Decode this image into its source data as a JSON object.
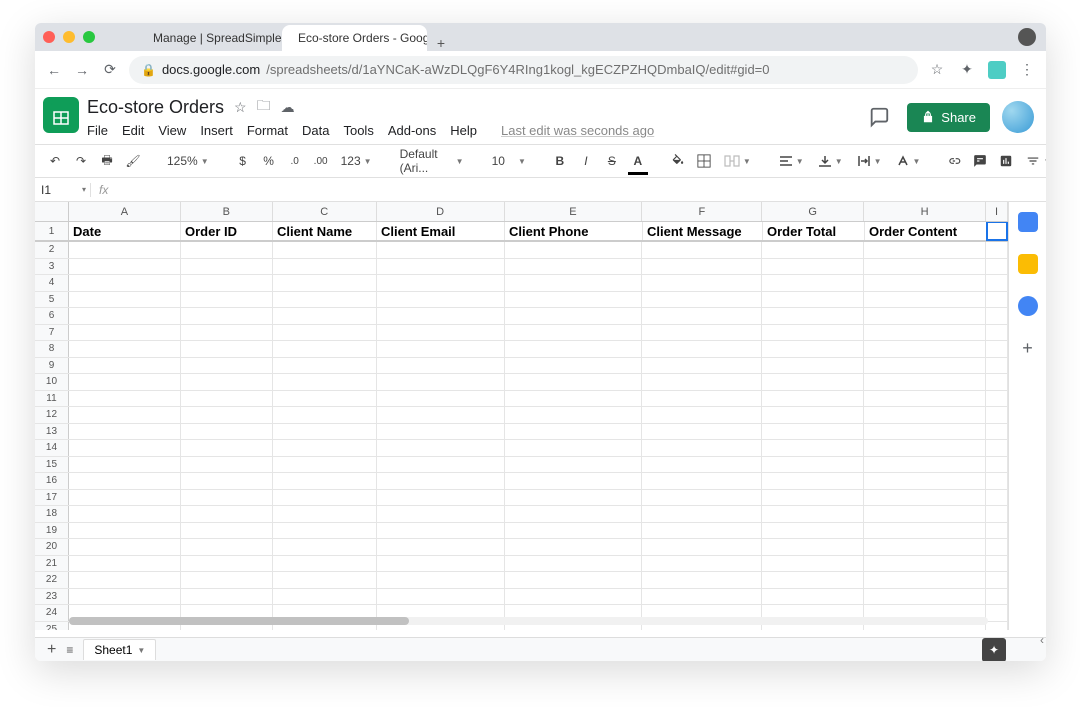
{
  "browser_tabs": [
    {
      "label": "Manage | SpreadSimple",
      "active": false
    },
    {
      "label": "Eco-store Orders - Google She",
      "active": true
    }
  ],
  "url_host": "docs.google.com",
  "url_path": "/spreadsheets/d/1aYNCaK-aWzDLQgF6Y4RIng1kogl_kgECZPZHQDmbaIQ/edit#gid=0",
  "doc_title": "Eco-store Orders",
  "menus": [
    "File",
    "Edit",
    "View",
    "Insert",
    "Format",
    "Data",
    "Tools",
    "Add-ons",
    "Help"
  ],
  "last_edit": "Last edit was seconds ago",
  "share_label": "Share",
  "toolbar": {
    "zoom": "125%",
    "number_format": "123",
    "font_name": "Default (Ari...",
    "font_size": "10"
  },
  "namebox_value": "I1",
  "columns": [
    {
      "letter": "A",
      "w": 112
    },
    {
      "letter": "B",
      "w": 92
    },
    {
      "letter": "C",
      "w": 104
    },
    {
      "letter": "D",
      "w": 128
    },
    {
      "letter": "E",
      "w": 138
    },
    {
      "letter": "F",
      "w": 120
    },
    {
      "letter": "G",
      "w": 102
    },
    {
      "letter": "H",
      "w": 122
    },
    {
      "letter": "I",
      "w": 22
    }
  ],
  "header_cells": [
    "Date",
    "Order ID",
    "Client Name",
    "Client Email",
    "Client Phone",
    "Client Message",
    "Order Total",
    "Order Content",
    ""
  ],
  "row_count": 28,
  "sheet_tab": "Sheet1",
  "chart_data": null
}
